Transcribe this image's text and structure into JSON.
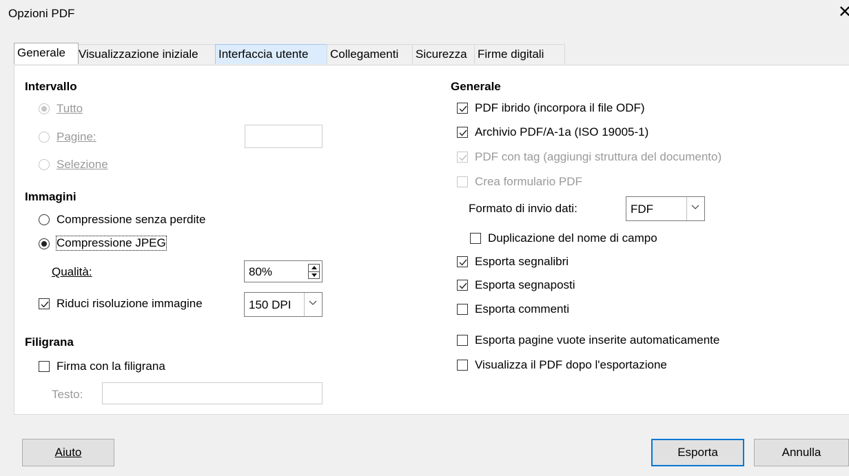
{
  "window": {
    "title": "Opzioni PDF",
    "close_glyph": "✕"
  },
  "tabs": [
    {
      "label": "Generale",
      "state": "active"
    },
    {
      "label": "Visualizzazione iniziale",
      "state": "normal"
    },
    {
      "label": "Interfaccia utente",
      "state": "hover"
    },
    {
      "label": "Collegamenti",
      "state": "normal"
    },
    {
      "label": "Sicurezza",
      "state": "normal"
    },
    {
      "label": "Firme digitali",
      "state": "normal"
    }
  ],
  "left": {
    "intervallo": {
      "heading": "Intervallo",
      "tutto": {
        "label": "Tutto",
        "selected": true,
        "enabled": false
      },
      "pagine": {
        "label": "Pagine:",
        "selected": false,
        "enabled": false,
        "value": ""
      },
      "selezione": {
        "label": "Selezione",
        "selected": false,
        "enabled": false
      }
    },
    "immagini": {
      "heading": "Immagini",
      "senza_perdite": {
        "label": "Compressione senza perdite",
        "selected": false
      },
      "jpeg": {
        "label": "Compressione JPEG",
        "selected": true
      },
      "qualita": {
        "label": "Qualità:",
        "value": "80%"
      },
      "riduci": {
        "label": "Riduci risoluzione immagine",
        "checked": true,
        "value": "150 DPI"
      }
    },
    "filigrana": {
      "heading": "Filigrana",
      "firma": {
        "label": "Firma con la filigrana",
        "checked": false
      },
      "testo": {
        "label": "Testo:",
        "value": ""
      }
    }
  },
  "right": {
    "heading": "Generale",
    "pdf_ibrido": {
      "label": "PDF ibrido (incorpora il file ODF)",
      "checked": true,
      "enabled": true
    },
    "archivio": {
      "label": "Archivio PDF/A-1a (ISO 19005-1)",
      "checked": true,
      "enabled": true
    },
    "pdf_tag": {
      "label": "PDF con tag (aggiungi struttura del documento)",
      "checked": true,
      "enabled": false
    },
    "crea_form": {
      "label": "Crea formulario PDF",
      "checked": false,
      "enabled": false
    },
    "formato": {
      "label": "Formato di invio dati:",
      "value": "FDF"
    },
    "duplicazione": {
      "label": "Duplicazione del nome di campo",
      "checked": false
    },
    "segnalibri": {
      "label": "Esporta segnalibri",
      "checked": true
    },
    "segnaposti": {
      "label": "Esporta segnaposti",
      "checked": true
    },
    "commenti": {
      "label": "Esporta commenti",
      "checked": false
    },
    "pagine_vuote": {
      "label": "Esporta pagine vuote inserite automaticamente",
      "checked": false
    },
    "visualizza": {
      "label": "Visualizza il PDF dopo l'esportazione",
      "checked": false
    }
  },
  "buttons": {
    "aiuto": "Aiuto",
    "esporta": "Esporta",
    "annulla": "Annulla"
  },
  "colors": {
    "accent": "#0078d7",
    "tab_hover": "#dcecfc",
    "disabled_text": "#9a9a9a"
  }
}
